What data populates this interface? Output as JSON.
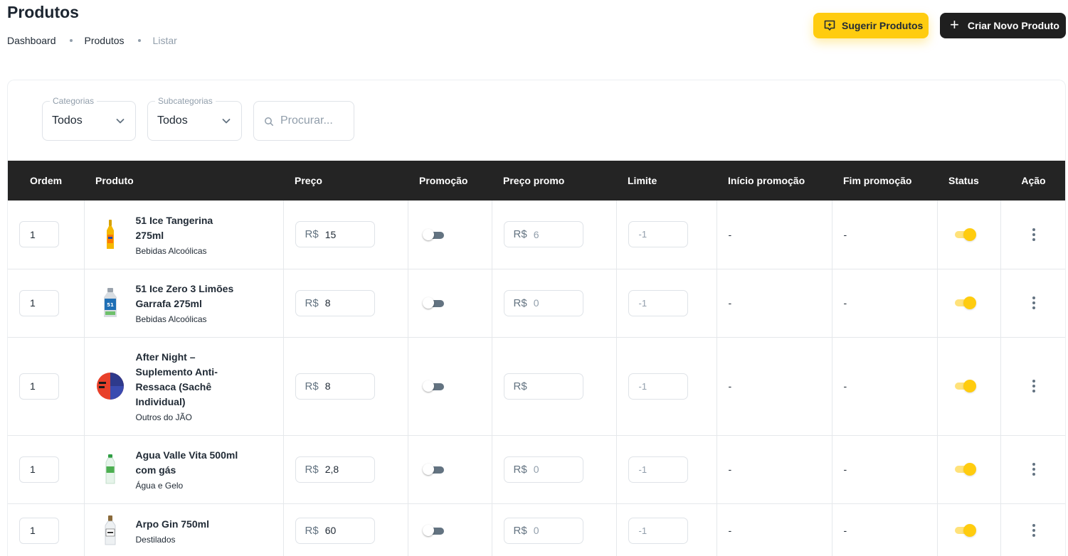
{
  "header": {
    "title": "Produtos",
    "breadcrumb": [
      "Dashboard",
      "Produtos",
      "Listar"
    ],
    "suggest_label": "Sugerir Produtos",
    "create_label": "Criar Novo Produto"
  },
  "filters": {
    "categories_label": "Categorias",
    "categories_value": "Todos",
    "subcategories_label": "Subcategorias",
    "subcategories_value": "Todos",
    "search_placeholder": "Procurar..."
  },
  "table": {
    "columns": [
      "Ordem",
      "Produto",
      "Preço",
      "Promoção",
      "Preço promo",
      "Limite",
      "Início promoção",
      "Fim promoção",
      "Status",
      "Ação"
    ],
    "currency": "R$",
    "rows": [
      {
        "order": "1",
        "name": "51 Ice Tangerina 275ml",
        "category": "Bebidas Alcoólicas",
        "price": "15",
        "promo_on": false,
        "promo_price": "6",
        "limit": "-1",
        "promo_start": "-",
        "promo_end": "-",
        "status_on": true,
        "thumb": "orange-bottle"
      },
      {
        "order": "1",
        "name": "51 Ice Zero 3 Limões Garrafa 275ml",
        "category": "Bebidas Alcoólicas",
        "price": "8",
        "promo_on": false,
        "promo_price": "0",
        "limit": "-1",
        "promo_start": "-",
        "promo_end": "-",
        "status_on": true,
        "thumb": "silver-can"
      },
      {
        "order": "1",
        "name": "After Night – Suplemento Anti-Ressaca (Sachê Individual)",
        "category": "Outros do JÃO",
        "price": "8",
        "promo_on": false,
        "promo_price": "",
        "limit": "-1",
        "promo_start": "-",
        "promo_end": "-",
        "status_on": true,
        "thumb": "round-sachet"
      },
      {
        "order": "1",
        "name": "Agua Valle Vita 500ml com gás",
        "category": "Água e Gelo",
        "price": "2,8",
        "promo_on": false,
        "promo_price": "0",
        "limit": "-1",
        "promo_start": "-",
        "promo_end": "-",
        "status_on": true,
        "thumb": "water-bottle"
      },
      {
        "order": "1",
        "name": "Arpo Gin 750ml",
        "category": "Destilados",
        "price": "60",
        "promo_on": false,
        "promo_price": "0",
        "limit": "-1",
        "promo_start": "-",
        "promo_end": "-",
        "status_on": true,
        "thumb": "gin-bottle"
      }
    ]
  }
}
